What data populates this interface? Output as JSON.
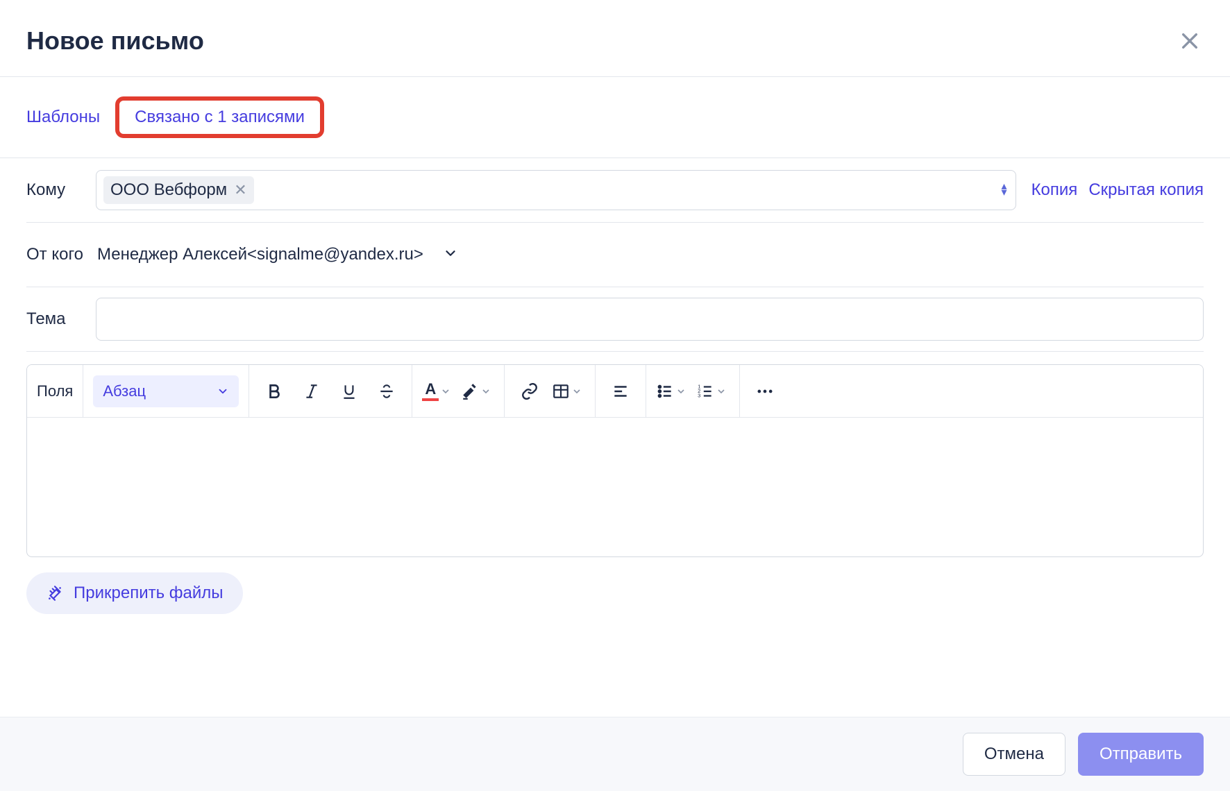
{
  "header": {
    "title": "Новое письмо"
  },
  "tabs": {
    "templates": "Шаблоны",
    "related": "Связано с 1 записями"
  },
  "to": {
    "label": "Кому",
    "chip": "ООО Вебформ",
    "cc": "Копия",
    "bcc": "Скрытая копия"
  },
  "from": {
    "label": "От кого",
    "value": "Менеджер Алексей<signalme@yandex.ru>"
  },
  "subject": {
    "label": "Тема",
    "value": ""
  },
  "toolbar": {
    "fields": "Поля",
    "paragraph": "Абзац"
  },
  "attach": {
    "label": "Прикрепить файлы"
  },
  "footer": {
    "cancel": "Отмена",
    "send": "Отправить"
  }
}
